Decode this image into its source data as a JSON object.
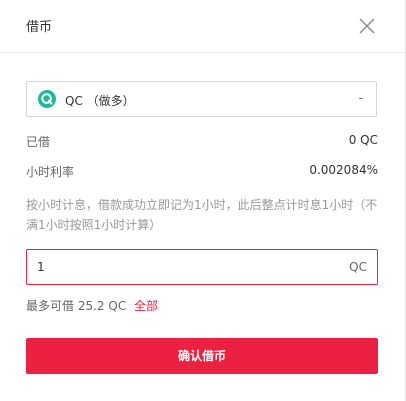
{
  "dialog": {
    "title": "借币"
  },
  "currency_select": {
    "label": "QC （做多）",
    "arrow": "-"
  },
  "borrowed": {
    "label": "已借",
    "value": "0 QC"
  },
  "hourly_rate": {
    "label": "小时利率",
    "value": "0.002084%"
  },
  "note": "按小时计息，借款成功立即记为1小时，此后整点计时息1小时（不满1小时按照1小时计算）",
  "amount": {
    "value": "1",
    "unit": "QC"
  },
  "max_borrow": {
    "label": "最多可借",
    "value": "25.2 QC",
    "all_link": "全部"
  },
  "confirm_button": "确认借币",
  "colors": {
    "accent": "#ec2041",
    "coin_icon": "#1bb99a"
  }
}
